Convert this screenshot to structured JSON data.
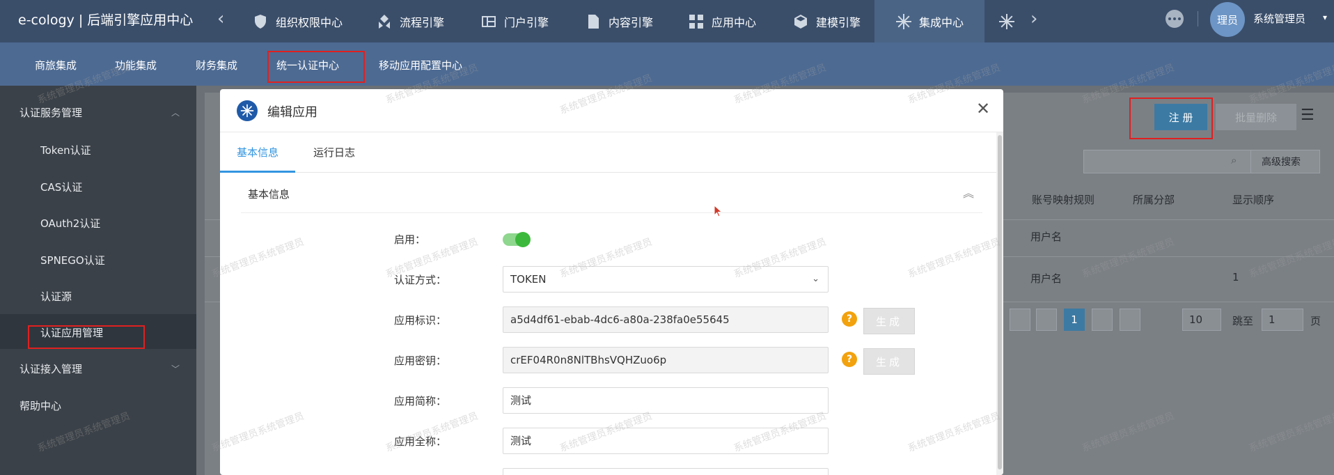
{
  "app": {
    "brand": "e-cology | 后端引擎应用中心"
  },
  "topnav": {
    "items": [
      {
        "label": "组织权限中心",
        "icon": "shield-icon"
      },
      {
        "label": "流程引擎",
        "icon": "workflow-icon"
      },
      {
        "label": "门户引擎",
        "icon": "portal-icon"
      },
      {
        "label": "内容引擎",
        "icon": "document-icon"
      },
      {
        "label": "应用中心",
        "icon": "grid-icon"
      },
      {
        "label": "建模引擎",
        "icon": "cube-icon"
      },
      {
        "label": "集成中心",
        "icon": "snowflake-icon"
      }
    ],
    "avatar_text": "理员",
    "username": "系统管理员"
  },
  "subnav": {
    "items": [
      "商旅集成",
      "功能集成",
      "财务集成",
      "统一认证中心",
      "移动应用配置中心"
    ]
  },
  "sidebar": {
    "group1": "认证服务管理",
    "items": [
      "Token认证",
      "CAS认证",
      "OAuth2认证",
      "SPNEGO认证",
      "认证源",
      "认证应用管理"
    ],
    "group2": "认证接入管理",
    "group3": "帮助中心"
  },
  "background_page": {
    "register_button": "注 册",
    "batch_delete_button": "批量删除",
    "advanced_search": "高级搜索",
    "columns": [
      "账号映射规则",
      "所属分部",
      "显示顺序"
    ],
    "rows": [
      {
        "rule": "用户名",
        "order": ""
      },
      {
        "rule": "用户名",
        "order": "1"
      }
    ],
    "pagination": {
      "current": "1",
      "page_size": "10",
      "jump_label": "跳至",
      "jump_value": "1",
      "page_suffix": "页"
    }
  },
  "modal": {
    "title": "编辑应用",
    "tabs": [
      "基本信息",
      "运行日志"
    ],
    "section_title": "基本信息",
    "fields": {
      "enable_label": "启用：",
      "auth_method_label": "认证方式：",
      "auth_method_value": "TOKEN",
      "app_id_label": "应用标识：",
      "app_id_value": "a5d4df61-ebab-4dc6-a80a-238fa0e55645",
      "app_secret_label": "应用密钥：",
      "app_secret_value": "crEF04R0n8NlTBhsVQHZuo6p",
      "short_name_label": "应用简称：",
      "short_name_value": "测试",
      "full_name_label": "应用全称：",
      "full_name_value": "测试"
    },
    "generate_label": "生成",
    "help_symbol": "?"
  },
  "watermark": "系统管理员系统管理员",
  "colors": {
    "accent": "#3295e0",
    "topbar": "#3a4e6a",
    "subnav": "#4d6a92",
    "sidebar": "#3b4148",
    "toggle_on": "#3cb93c",
    "help": "#f2a20e",
    "highlight": "#e02020"
  }
}
